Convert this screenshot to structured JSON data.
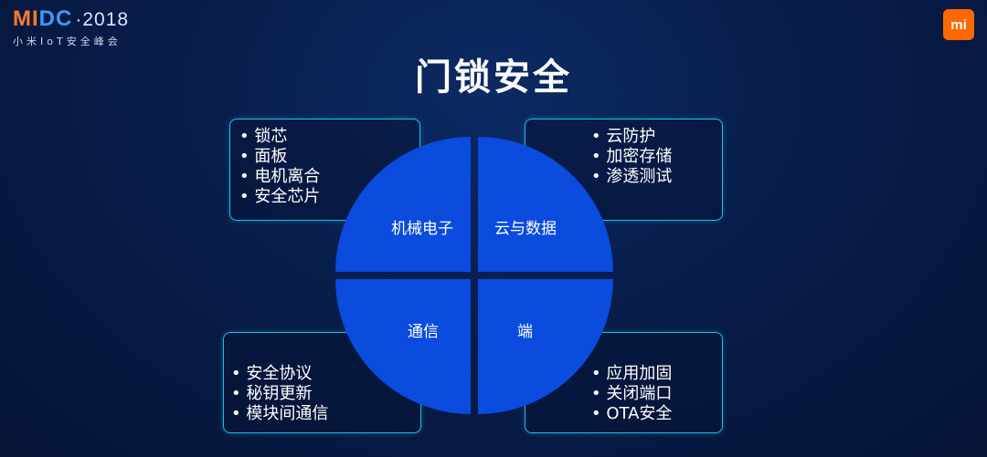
{
  "brand": {
    "logo_mi": "MI",
    "logo_dc": "DC",
    "logo_year": "·2018",
    "logo_subtitle": "小米IoT安全峰会",
    "badge": "mi"
  },
  "title": "门锁安全",
  "colors": {
    "quadrant": "#0b4bde",
    "box_border": "#19c1e6",
    "background": "#081d4a"
  },
  "quadrants": [
    {
      "label": "机械电子",
      "items": [
        "锁芯",
        "面板",
        "电机离合",
        "安全芯片"
      ]
    },
    {
      "label": "云与数据",
      "items": [
        "云防护",
        "加密存储",
        "渗透测试"
      ]
    },
    {
      "label": "通信",
      "items": [
        "安全协议",
        "秘钥更新",
        "模块间通信"
      ]
    },
    {
      "label": "端",
      "items": [
        "应用加固",
        "关闭端口",
        "OTA安全"
      ]
    }
  ]
}
